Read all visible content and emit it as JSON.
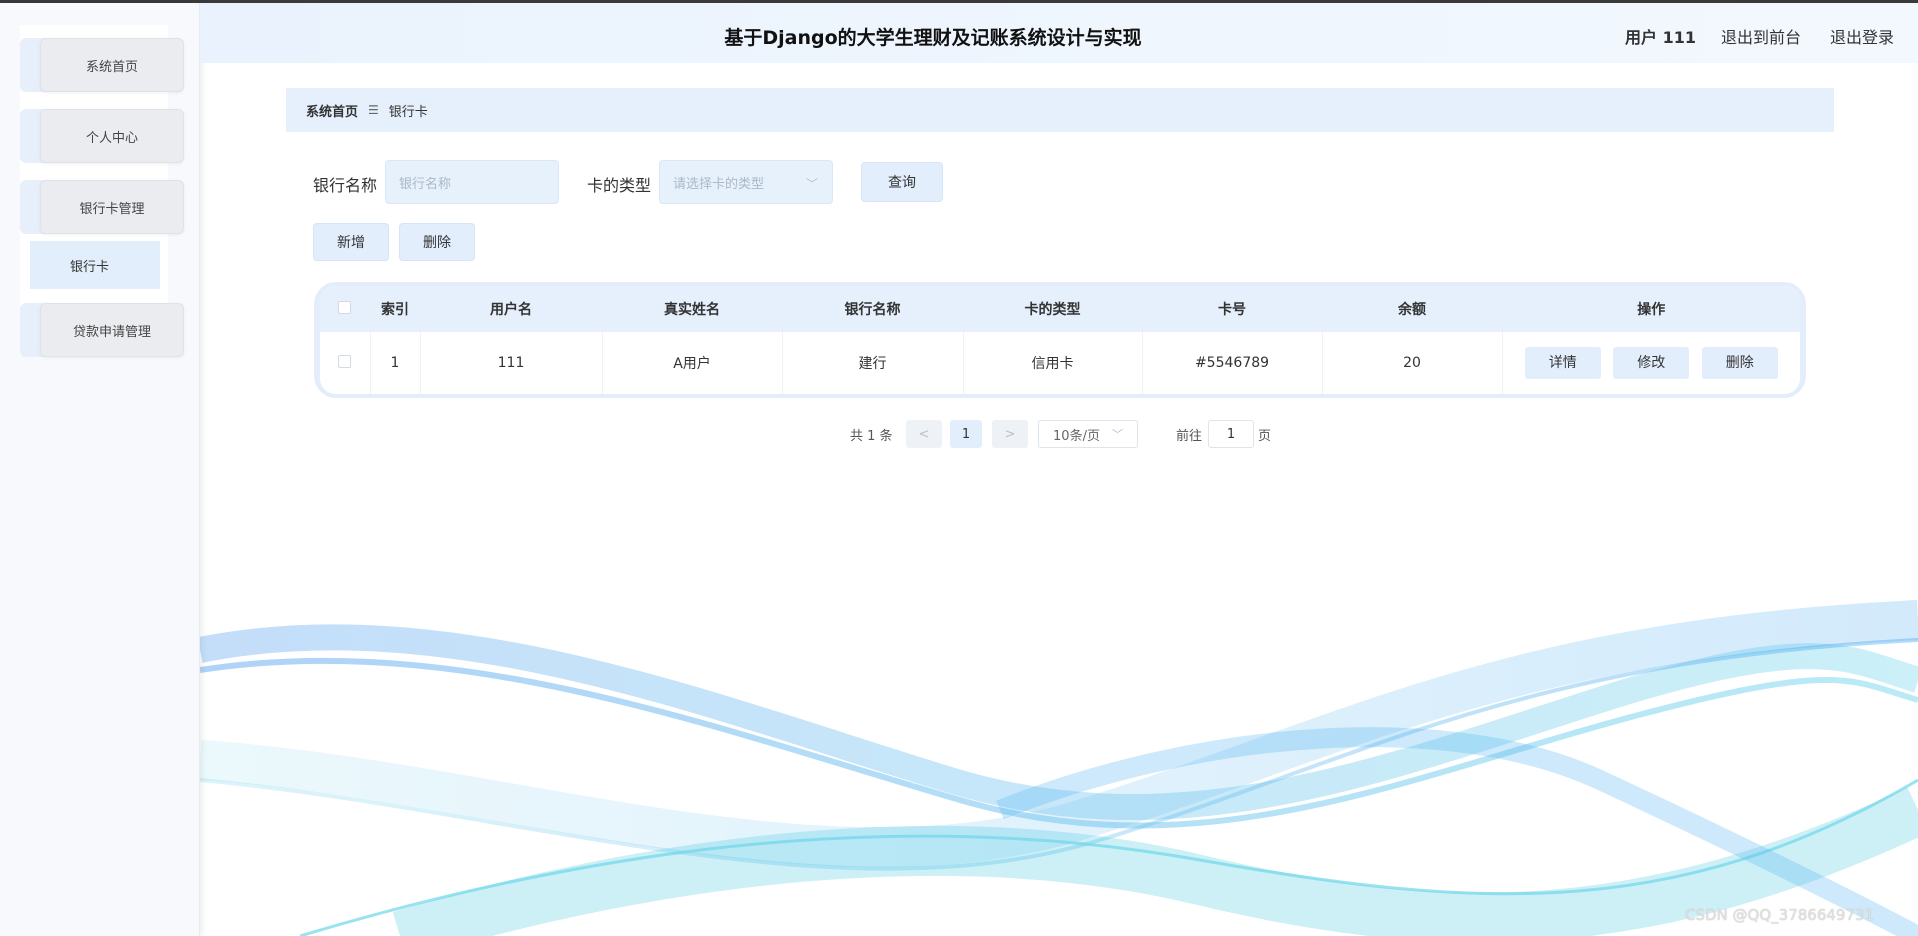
{
  "header": {
    "title": "基于Django的大学生理财及记账系统设计与实现",
    "user": "用户 111",
    "to_front": "退出到前台",
    "logout": "退出登录"
  },
  "sidebar": {
    "items": [
      {
        "label": "系统首页"
      },
      {
        "label": "个人中心"
      },
      {
        "label": "银行卡管理"
      },
      {
        "label": "贷款申请管理"
      }
    ],
    "sub_items": [
      {
        "label": "银行卡"
      }
    ]
  },
  "breadcrumb": {
    "home": "系统首页",
    "sep": "☰",
    "current": "银行卡"
  },
  "search": {
    "bank_label": "银行名称",
    "bank_placeholder": "银行名称",
    "type_label": "卡的类型",
    "type_placeholder": "请选择卡的类型",
    "query_button": "查询"
  },
  "actions": {
    "add": "新增",
    "delete": "删除"
  },
  "table": {
    "headers": [
      "索引",
      "用户名",
      "真实姓名",
      "银行名称",
      "卡的类型",
      "卡号",
      "余额",
      "操作"
    ],
    "rows": [
      {
        "index": "1",
        "username": "111",
        "realname": "A用户",
        "bank": "建行",
        "type": "信用卡",
        "number": "#5546789",
        "balance": "20"
      }
    ],
    "row_actions": {
      "detail": "详情",
      "edit": "修改",
      "delete": "删除"
    }
  },
  "pager": {
    "total": "共 1 条",
    "prev": "<",
    "page": "1",
    "next": ">",
    "size": "10条/页",
    "goto_label": "前往",
    "goto_value": "1",
    "goto_suffix": "页"
  },
  "watermark": "CSDN @QQ_3786649731"
}
